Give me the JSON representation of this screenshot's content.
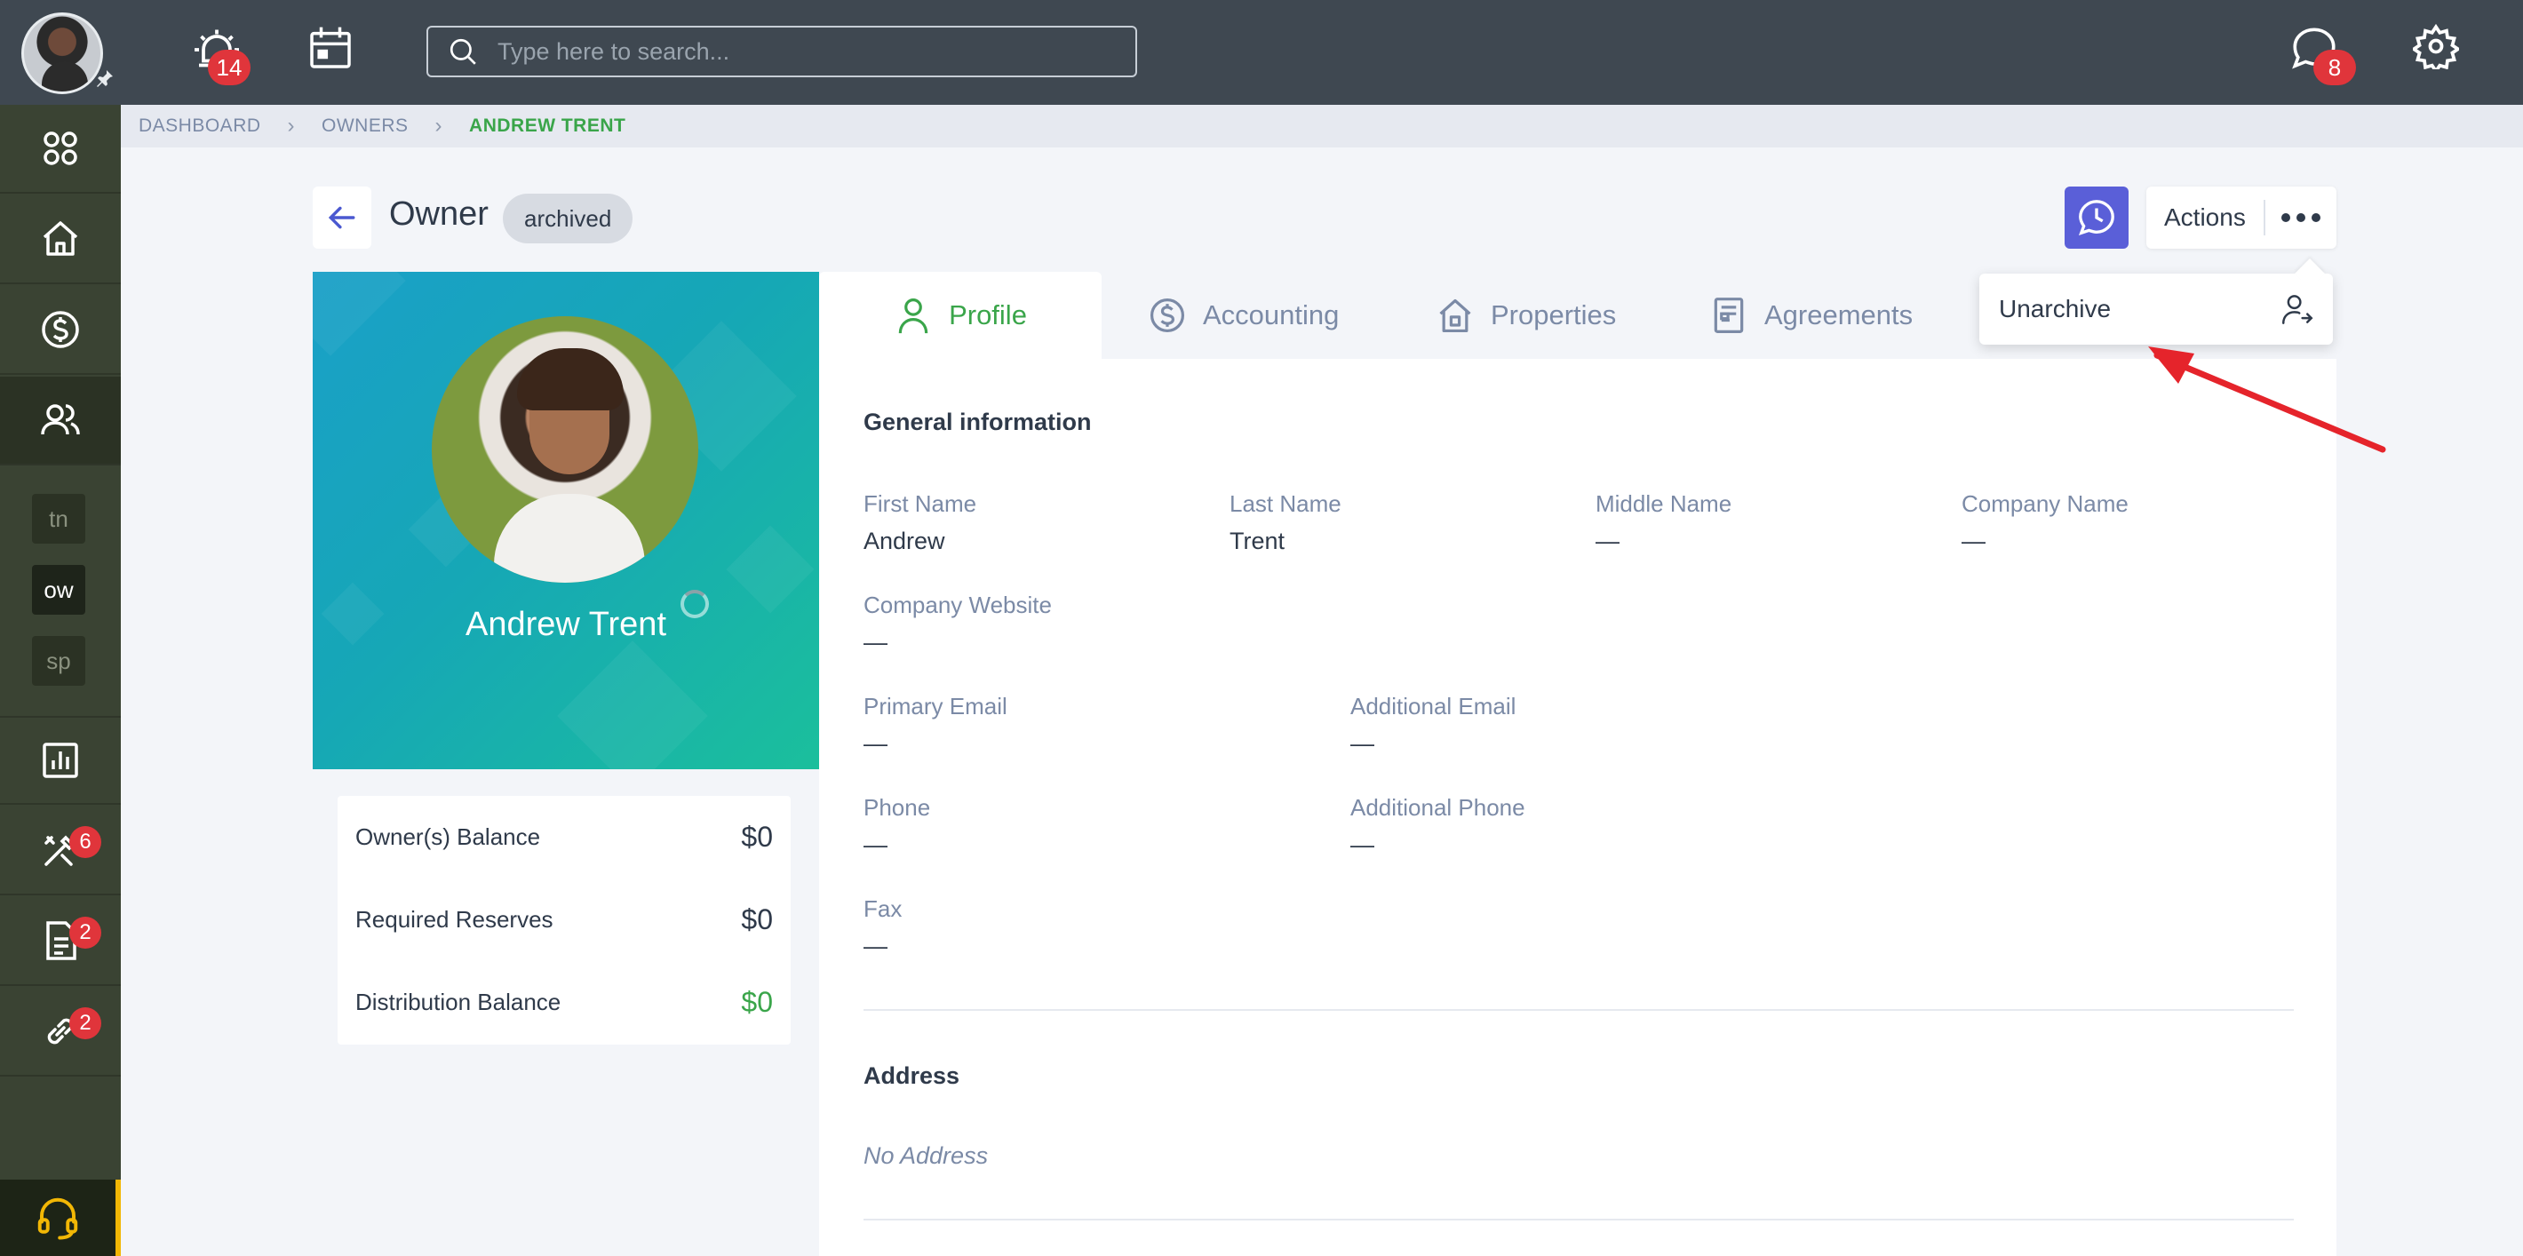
{
  "topbar": {
    "alerts_badge": "14",
    "search_placeholder": "Type here to search...",
    "messages_badge": "8"
  },
  "sidebar": {
    "chips": [
      "tn",
      "ow",
      "sp"
    ],
    "badges": {
      "maintenance": "6",
      "tasks": "2",
      "links": "2"
    }
  },
  "breadcrumb": {
    "items": [
      "DASHBOARD",
      "OWNERS",
      "ANDREW TRENT"
    ]
  },
  "header": {
    "title": "Owner",
    "status": "archived",
    "actions_label": "Actions"
  },
  "dropdown": {
    "item_label": "Unarchive"
  },
  "profile": {
    "name": "Andrew Trent",
    "balances": [
      {
        "name": "Owner(s) Balance",
        "value": "$0"
      },
      {
        "name": "Required Reserves",
        "value": "$0"
      },
      {
        "name": "Distribution Balance",
        "value": "$0"
      }
    ]
  },
  "tabs": [
    "Profile",
    "Accounting",
    "Properties",
    "Agreements"
  ],
  "general": {
    "title": "General information",
    "first_name_label": "First Name",
    "first_name": "Andrew",
    "last_name_label": "Last Name",
    "last_name": "Trent",
    "middle_name_label": "Middle Name",
    "middle_name": "—",
    "company_name_label": "Company Name",
    "company_name": "—",
    "company_website_label": "Company Website",
    "company_website": "—",
    "primary_email_label": "Primary Email",
    "primary_email": "—",
    "additional_email_label": "Additional Email",
    "additional_email": "—",
    "phone_label": "Phone",
    "phone": "—",
    "additional_phone_label": "Additional Phone",
    "additional_phone": "—",
    "fax_label": "Fax",
    "fax": "—"
  },
  "address": {
    "title": "Address",
    "empty": "No Address"
  },
  "icons": {
    "alerts": "alarm-icon",
    "calendar": "calendar-icon",
    "search": "search-icon",
    "messages": "chat-icon",
    "settings": "gear-icon",
    "back": "arrow-left-icon",
    "history": "clock-icon",
    "more": "more-dots-icon",
    "unarchive": "user-arrow-icon",
    "support": "headset-icon"
  },
  "colors": {
    "accent_green": "#3aa54a",
    "accent_purple": "#5a5fd8",
    "badge_red": "#e0353b",
    "topbar": "#3f4851",
    "sidebar": "#3a4333",
    "annotation_arrow": "#e5242b"
  }
}
